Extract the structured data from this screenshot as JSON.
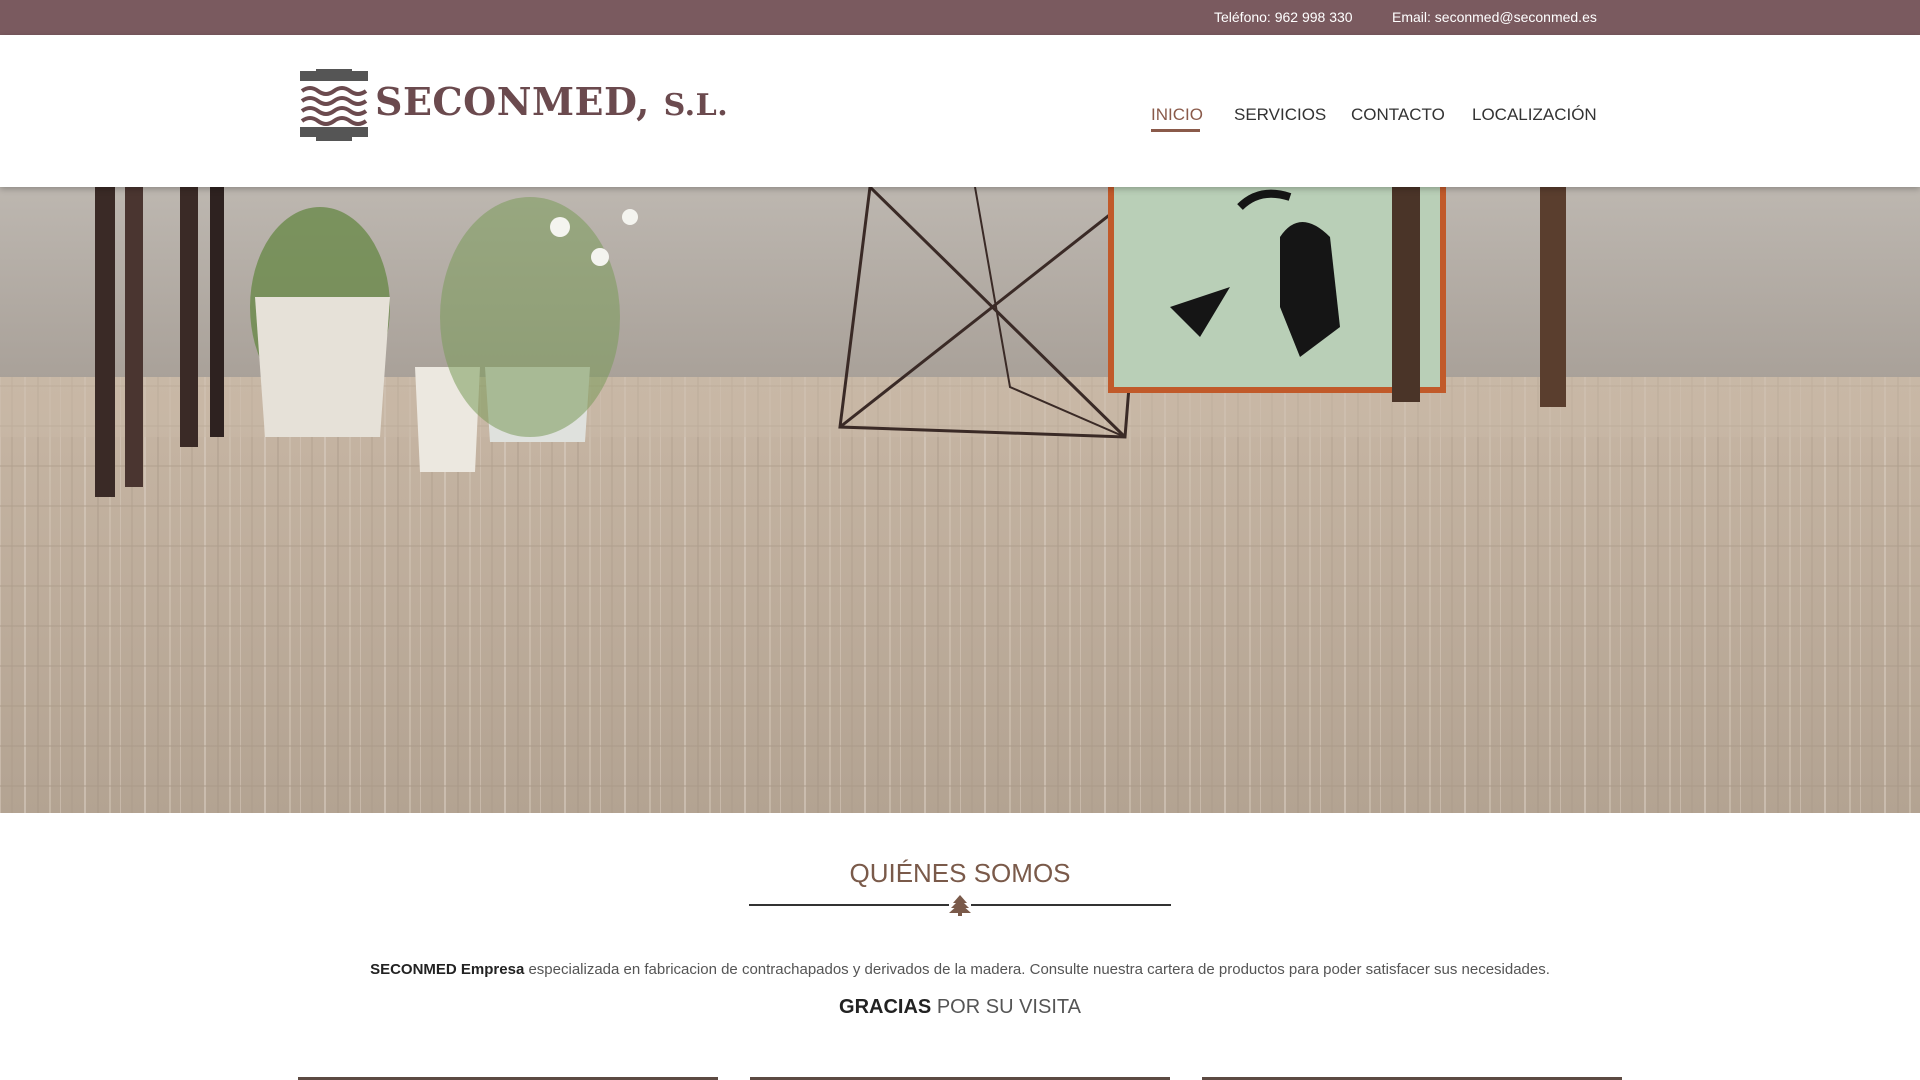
{
  "topbar": {
    "phone": "Teléfono: 962 998 330",
    "email": "Email: seconmed@seconmed.es"
  },
  "header": {
    "logo_text_main": "SECONMED,",
    "logo_text_suffix": "S.L.",
    "nav": [
      {
        "label": "INICIO",
        "active": true
      },
      {
        "label": "SERVICIOS",
        "active": false
      },
      {
        "label": "CONTACTO",
        "active": false
      },
      {
        "label": "LOCALIZACIÓN",
        "active": false
      }
    ]
  },
  "about": {
    "title": "QUIÉNES SOMOS",
    "divider_icon": "tree-icon",
    "text_bold": "SECONMED Empresa",
    "text_rest": "especializada en fabricacion de contrachapados y derivados de la madera. Consulte nuestra cartera de productos para poder satisfacer sus necesidades.",
    "thanks_bold": "GRACIAS",
    "thanks_rest": "POR SU VISITA"
  },
  "colors": {
    "topbar": "#7a5a5f",
    "accent": "#8a5a4a",
    "logo": "#6b4a4e",
    "floor": "#b8a898"
  }
}
